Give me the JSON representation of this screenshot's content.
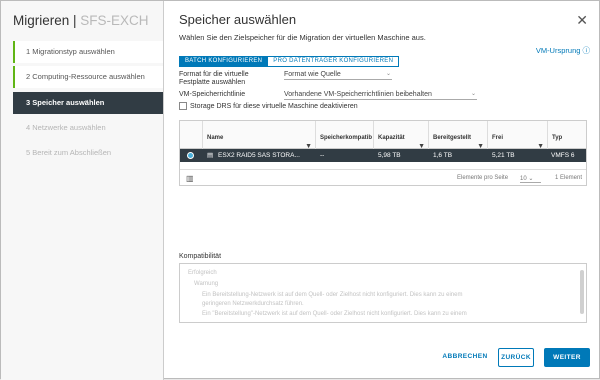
{
  "sidebar": {
    "title_prefix": "Migrieren | ",
    "title_vm": "SFS-EXCH",
    "steps": [
      {
        "label": "1  Migrationstyp auswählen",
        "state": "done"
      },
      {
        "label": "2  Computing-Ressource auswählen",
        "state": "done"
      },
      {
        "label": "3  Speicher auswählen",
        "state": "active"
      },
      {
        "label": "4  Netzwerke auswählen",
        "state": "pending"
      },
      {
        "label": "5  Bereit zum Abschließen",
        "state": "pending"
      }
    ]
  },
  "main": {
    "title": "Speicher auswählen",
    "subtitle": "Wählen Sie den Zielspeicher für die Migration der virtuellen Maschine aus.",
    "vm_origin_link": "VM-Ursprung",
    "tabs": [
      "BATCH KONFIGURIEREN",
      "PRO DATENTRÄGER KONFIGURIEREN"
    ],
    "format_label_line1": "Format für die virtuelle",
    "format_label_line2": "Festplatte auswählen",
    "format_value": "Format wie Quelle",
    "policy_label": "VM-Speicherrichtlinie",
    "policy_value": "Vorhandene VM-Speicherrichtlinien beibehalten",
    "drs_checkbox": "Storage DRS für diese virtuelle Maschine deaktivieren",
    "table": {
      "headers": [
        "Name",
        "Speicherkompatib",
        "Kapazität",
        "Bereitgestellt",
        "Frei",
        "Typ"
      ],
      "row": [
        "ESX2 RAID5 SAS STORA...",
        "--",
        "5,98 TB",
        "1,6 TB",
        "5,21 TB",
        "VMFS 6"
      ],
      "footer_per_page_label": "Elemente pro Seite",
      "footer_per_page_value": "10",
      "footer_count": "1 Element"
    },
    "compat_label": "Kompatibilität",
    "compat_lines": [
      "Erfolgreich",
      "Warnung",
      "Ein Bereitstellung-Netzwerk ist auf dem Quell- oder Zielhost nicht konfiguriert. Dies kann zu einem",
      "geringeren Netzwerkdurchsatz führen.",
      "Ein \"Bereitstellung\"-Netzwerk ist auf dem Quell- oder Zielhost nicht konfiguriert. Dies kann zu einem"
    ],
    "buttons": {
      "cancel": "ABBRECHEN",
      "back": "ZURÜCK",
      "next": "WEITER"
    }
  },
  "colors": {
    "accent": "#0079b8",
    "active_step": "#313c44",
    "done_marker": "#60b515"
  }
}
